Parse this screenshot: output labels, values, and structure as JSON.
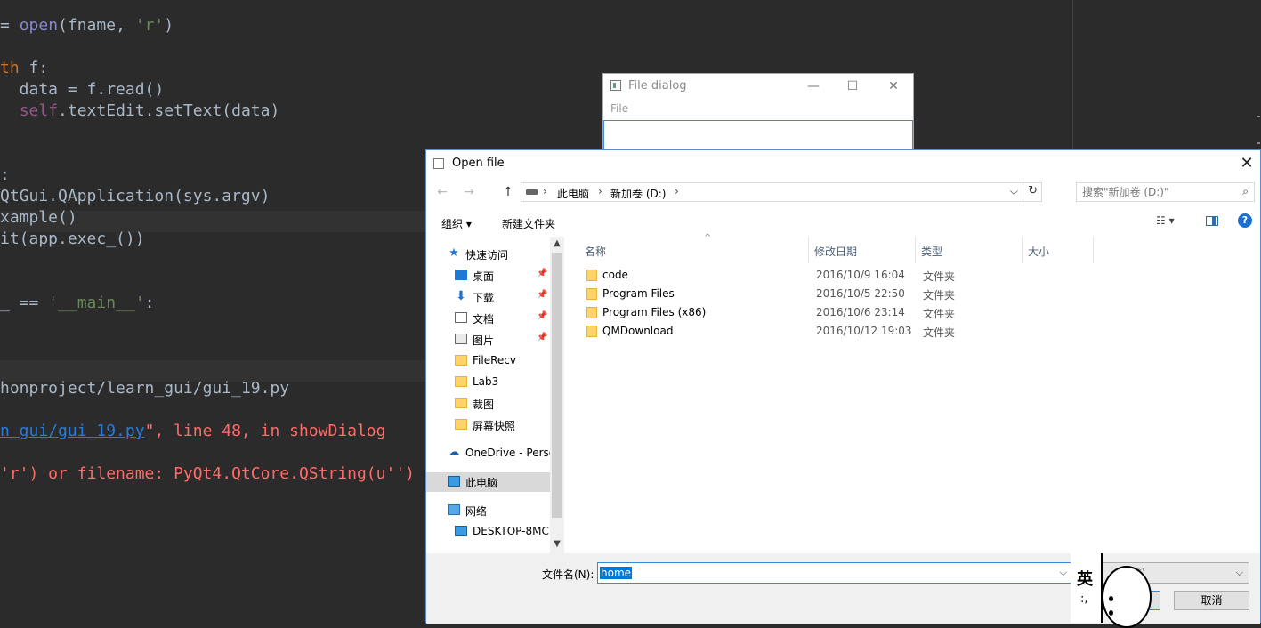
{
  "editor": {
    "lines": [
      {
        "id": "l1",
        "parts": [
          [
            "",
            "= "
          ],
          [
            "bi",
            "open"
          ],
          [
            "",
            "(fname, "
          ],
          [
            "str",
            "'r'"
          ],
          [
            "",
            ")"
          ]
        ]
      },
      {
        "id": "l2",
        "parts": [
          [
            "kw",
            "th"
          ],
          [
            "",
            " f:"
          ]
        ]
      },
      {
        "id": "l3",
        "parts": [
          [
            "",
            "  data = f.read()"
          ]
        ]
      },
      {
        "id": "l4",
        "parts": [
          [
            "",
            "  "
          ],
          [
            "slf",
            "self"
          ],
          [
            "",
            ".textEdit.setText(data)"
          ]
        ]
      },
      {
        "id": "l5",
        "parts": [
          [
            "",
            ":"
          ]
        ]
      },
      {
        "id": "l6",
        "parts": [
          [
            "",
            "QtGui.QApplication(sys.argv)"
          ]
        ]
      },
      {
        "id": "l7",
        "parts": [
          [
            "",
            "xample()"
          ]
        ]
      },
      {
        "id": "l8",
        "parts": [
          [
            "",
            "it(app.exec_())"
          ]
        ]
      },
      {
        "id": "l9",
        "parts": [
          [
            "",
            "_ == "
          ],
          [
            "str",
            "'__main__'"
          ],
          [
            "",
            ":"
          ]
        ]
      },
      {
        "id": "l10",
        "parts": [
          [
            "",
            "honproject/learn_gui/gui_19.py"
          ]
        ]
      },
      {
        "id": "l11",
        "parts": [
          [
            "lnk",
            "n_gui/gui_19.py"
          ],
          [
            "err",
            "\", line 48, in showDialog"
          ]
        ]
      },
      {
        "id": "l12",
        "parts": [
          [
            "err",
            "'r') or filename: PyQt4.QtCore.QString(u'')"
          ]
        ]
      }
    ]
  },
  "small_window": {
    "title": "File dialog",
    "minimize": "—",
    "maximize": "☐",
    "close": "✕",
    "menu_file": "File"
  },
  "dialog": {
    "title": "Open file",
    "close": "✕",
    "nav": {
      "back": "←",
      "forward": "→",
      "up": "↑"
    },
    "breadcrumb": [
      "此电脑",
      "新加卷 (D:)"
    ],
    "breadcrumb_sep": "›",
    "search_placeholder": "搜索\"新加卷 (D:)\"",
    "toolbar": {
      "organize": "组织 ▾",
      "new_folder": "新建文件夹",
      "view": "☷ ▾",
      "help": "?"
    },
    "sidebar": [
      {
        "label": "快速访问",
        "icon": "star-icon",
        "cls": "star-ico",
        "glyph": "★",
        "pin": false
      },
      {
        "label": "桌面",
        "icon": "desktop-icon",
        "cls": "desk-ico",
        "glyph": "",
        "pin": true
      },
      {
        "label": "下载",
        "icon": "download-icon",
        "cls": "down-ico",
        "glyph": "⬇",
        "pin": true
      },
      {
        "label": "文档",
        "icon": "document-icon",
        "cls": "doc-ico",
        "glyph": "",
        "pin": true
      },
      {
        "label": "图片",
        "icon": "picture-icon",
        "cls": "pic-ico",
        "glyph": "",
        "pin": true
      },
      {
        "label": "FileRecv",
        "icon": "folder-icon",
        "cls": "folder-ico",
        "glyph": "",
        "pin": false
      },
      {
        "label": "Lab3",
        "icon": "folder-icon",
        "cls": "folder-ico",
        "glyph": "",
        "pin": false
      },
      {
        "label": "裁图",
        "icon": "folder-icon",
        "cls": "folder-ico",
        "glyph": "",
        "pin": false
      },
      {
        "label": "屏幕快照",
        "icon": "folder-icon",
        "cls": "folder-ico",
        "glyph": "",
        "pin": false
      },
      {
        "label": "OneDrive - Perso",
        "icon": "onedrive-icon",
        "cls": "cloud-ico",
        "glyph": "☁",
        "pin": false
      },
      {
        "label": "此电脑",
        "icon": "this-pc-icon",
        "cls": "pc-ico",
        "glyph": "",
        "pin": false,
        "selected": true
      },
      {
        "label": "网络",
        "icon": "network-icon",
        "cls": "net-ico",
        "glyph": "",
        "pin": false
      },
      {
        "label": "DESKTOP-8MC",
        "icon": "computer-icon",
        "cls": "pc-ico",
        "glyph": "",
        "pin": false
      }
    ],
    "columns": [
      "名称",
      "修改日期",
      "类型",
      "大小"
    ],
    "files": [
      {
        "name": "code",
        "date": "2016/10/9 16:04",
        "type": "文件夹"
      },
      {
        "name": "Program Files",
        "date": "2016/10/5 22:50",
        "type": "文件夹"
      },
      {
        "name": "Program Files (x86)",
        "date": "2016/10/6 23:14",
        "type": "文件夹"
      },
      {
        "name": "QMDownload",
        "date": "2016/10/12 19:03",
        "type": "文件夹"
      }
    ],
    "filename_label": "文件名(N):",
    "filename_value": "home",
    "filter_value": "(*.*)",
    "open_button": ")",
    "cancel_button": "取消"
  },
  "ime": {
    "char": "英",
    "punct": ":,"
  }
}
